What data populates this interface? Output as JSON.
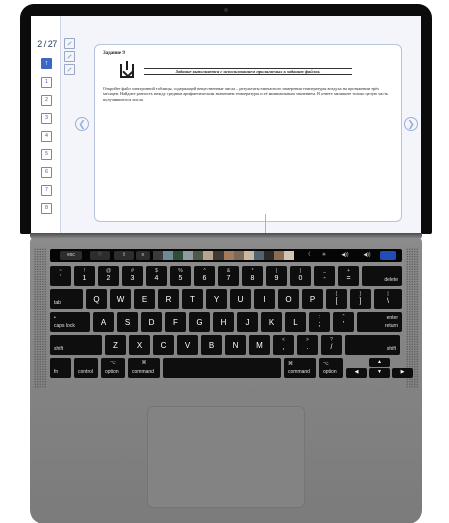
{
  "screen": {
    "counter": "2 / 27",
    "nav_items": [
      "↑",
      "1",
      "2",
      "3",
      "4",
      "5",
      "6",
      "7",
      "8"
    ],
    "task": {
      "title": "Задание 9",
      "notice": "Задание выполняется с использованием прилагаемых к заданию файлов.",
      "body": "Откройте файл электронной таблицы, содержащей вещественные числа – результаты ежечасного измерения температуры воздуха на протяжении трёх месяцев. Найдите разность между средним арифметическим значением температуры и её минимальным значением. В ответе запишите только целую часть получившегося числа."
    },
    "icons": [
      "expand-icon",
      "collapse-icon",
      "fullscreen-icon"
    ]
  },
  "touchbar": {
    "esc": "esc",
    "right_controls": [
      "〈",
      "☀",
      "◀))",
      "◀))",
      "🎙"
    ]
  },
  "keyboard": {
    "row1": [
      {
        "t": "~",
        "b": "`"
      },
      {
        "t": "!",
        "b": "1"
      },
      {
        "t": "@",
        "b": "2"
      },
      {
        "t": "#",
        "b": "3"
      },
      {
        "t": "$",
        "b": "4"
      },
      {
        "t": "%",
        "b": "5"
      },
      {
        "t": "^",
        "b": "6"
      },
      {
        "t": "&",
        "b": "7"
      },
      {
        "t": "*",
        "b": "8"
      },
      {
        "t": "(",
        "b": "9"
      },
      {
        "t": ")",
        "b": "0"
      },
      {
        "t": "_",
        "b": "-"
      },
      {
        "t": "+",
        "b": "="
      }
    ],
    "delete": "delete",
    "tab": "tab",
    "row2": [
      "Q",
      "W",
      "E",
      "R",
      "T",
      "Y",
      "U",
      "I",
      "O",
      "P"
    ],
    "brackets": [
      {
        "t": "{",
        "b": "["
      },
      {
        "t": "}",
        "b": "]"
      },
      {
        "t": "|",
        "b": "\\"
      }
    ],
    "caps": "caps lock",
    "row3": [
      "A",
      "S",
      "D",
      "F",
      "G",
      "H",
      "J",
      "K",
      "L"
    ],
    "semi": [
      {
        "t": ":",
        "b": ";"
      },
      {
        "t": "\"",
        "b": "'"
      }
    ],
    "enter": "enter",
    "return": "return",
    "shift": "shift",
    "row4": [
      "Z",
      "X",
      "C",
      "V",
      "B",
      "N",
      "M"
    ],
    "punct": [
      {
        "t": "<",
        "b": ","
      },
      {
        "t": ">",
        "b": "."
      },
      {
        "t": "?",
        "b": "/"
      }
    ],
    "fn": "fn",
    "control": "control",
    "option": "option",
    "command": "command",
    "cmd_symbol": "⌘",
    "opt_symbol": "⌥",
    "arrows": [
      "◀",
      "▲",
      "▼",
      "▶"
    ]
  }
}
